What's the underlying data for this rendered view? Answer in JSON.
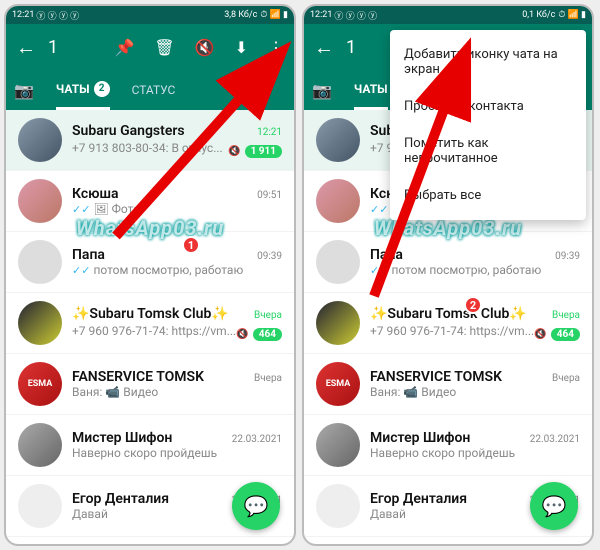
{
  "status": {
    "time": "12:21",
    "net": "3,8 Кб/с",
    "net2": "0,1 Кб/с"
  },
  "toolbar": {
    "selected": "1"
  },
  "tabs": {
    "chats": "ЧАТЫ",
    "badge": "2",
    "status": "СТАТУС"
  },
  "menu": {
    "add_shortcut": "Добавить иконку чата на экран",
    "view_contact": "Просмотр контакта",
    "mark_unread": "Пометить как непрочитанное",
    "select_all": "Выбрать все"
  },
  "chats": [
    {
      "name": "Subaru Gangsters",
      "msg": "+7 913 803-80-34: В отпус...",
      "time": "12:21",
      "badge": "1 911",
      "muted": true,
      "unread": true,
      "avatar": "a1"
    },
    {
      "name": "Ксюша",
      "msg": "Фото",
      "time": "09:51",
      "ticks": true,
      "photo": true,
      "avatar": "a2"
    },
    {
      "name": "Папа",
      "msg": "потом посмотрю, работаю",
      "time": "09:39",
      "ticks": true,
      "avatar": "a3"
    },
    {
      "name": "✨Subaru Tomsk Club✨",
      "msg": "+7 960 976-71-74: https://vm...",
      "time": "Вчера",
      "badge": "464",
      "muted": true,
      "unread": true,
      "avatar": "a4"
    },
    {
      "name": "FANSERVICE TOMSK",
      "msg": "Ваня: 📹 Видео",
      "time": "Вчера",
      "avatar": "a5",
      "avtext": "ESMA"
    },
    {
      "name": "Мистер Шифон",
      "msg": "Наверно скоро пройдешь",
      "time": "22.03.2021",
      "avatar": "a6"
    },
    {
      "name": "Егор Денталия",
      "msg": "Давай",
      "time": "22.03.2021",
      "avatar": "a7"
    }
  ],
  "watermark": "WhatsApp03.ru"
}
